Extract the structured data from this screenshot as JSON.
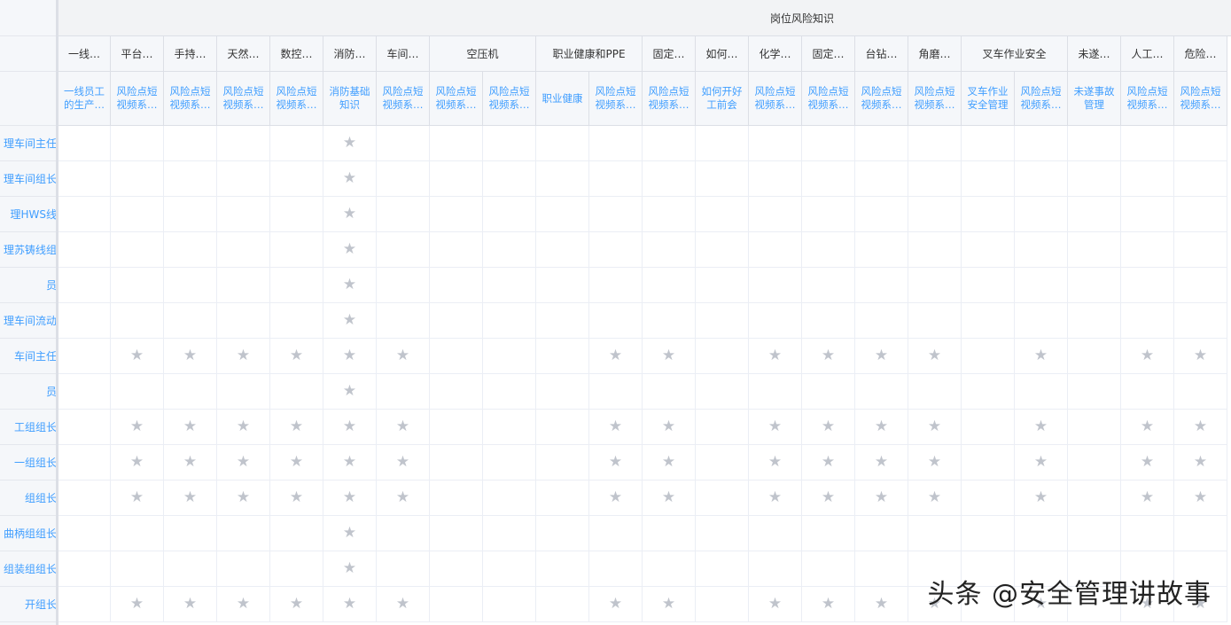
{
  "group_header": "岗位风险知识",
  "columns": [
    {
      "topic": "一线…",
      "course": "一线员工的生产…"
    },
    {
      "topic": "平台…",
      "course": "风险点短视频系…"
    },
    {
      "topic": "手持…",
      "course": "风险点短视频系…"
    },
    {
      "topic": "天然…",
      "course": "风险点短视频系…"
    },
    {
      "topic": "数控…",
      "course": "风险点短视频系…"
    },
    {
      "topic": "消防…",
      "course": "消防基础知识"
    },
    {
      "topic": "车间…",
      "course": "风险点短视频系…"
    },
    {
      "topic": "空压机",
      "course": "风险点短视频系…"
    },
    {
      "topic": "",
      "course": "风险点短视频系…"
    },
    {
      "topic": "职业健康和PPE",
      "course": "职业健康"
    },
    {
      "topic": "",
      "course": "风险点短视频系…"
    },
    {
      "topic": "固定…",
      "course": "风险点短视频系…"
    },
    {
      "topic": "如何…",
      "course": "如何开好工前会"
    },
    {
      "topic": "化学…",
      "course": "风险点短视频系…"
    },
    {
      "topic": "固定…",
      "course": "风险点短视频系…"
    },
    {
      "topic": "台钻…",
      "course": "风险点短视频系…"
    },
    {
      "topic": "角磨…",
      "course": "风险点短视频系…"
    },
    {
      "topic": "叉车作业安全",
      "course": "叉车作业安全管理"
    },
    {
      "topic": "",
      "course": "风险点短视频系…"
    },
    {
      "topic": "未遂…",
      "course": "未遂事故管理"
    },
    {
      "topic": "人工…",
      "course": "风险点短视频系…"
    },
    {
      "topic": "危险…",
      "course": "风险点短视频系…"
    }
  ],
  "rows": [
    {
      "label": "理车间主任",
      "stars": [
        5
      ]
    },
    {
      "label": "理车间组长",
      "stars": [
        5
      ]
    },
    {
      "label": "理HWS线",
      "stars": [
        5
      ]
    },
    {
      "label": "理苏铸线组",
      "stars": [
        5
      ]
    },
    {
      "label": "员",
      "stars": [
        5
      ]
    },
    {
      "label": "理车间流动",
      "stars": [
        5
      ]
    },
    {
      "label": "车间主任",
      "stars": [
        1,
        2,
        3,
        4,
        5,
        6,
        10,
        11,
        13,
        14,
        15,
        16,
        18,
        20,
        21
      ]
    },
    {
      "label": "员",
      "stars": [
        5
      ]
    },
    {
      "label": "工组组长",
      "stars": [
        1,
        2,
        3,
        4,
        5,
        6,
        10,
        11,
        13,
        14,
        15,
        16,
        18,
        20,
        21
      ]
    },
    {
      "label": "一组组长",
      "stars": [
        1,
        2,
        3,
        4,
        5,
        6,
        10,
        11,
        13,
        14,
        15,
        16,
        18,
        20,
        21
      ]
    },
    {
      "label": "组组长",
      "stars": [
        1,
        2,
        3,
        4,
        5,
        6,
        10,
        11,
        13,
        14,
        15,
        16,
        18,
        20,
        21
      ]
    },
    {
      "label": "曲柄组组长",
      "stars": [
        5
      ]
    },
    {
      "label": "组装组组长",
      "stars": [
        5
      ]
    },
    {
      "label": "开组长",
      "stars": [
        1,
        2,
        3,
        4,
        5,
        6,
        10,
        11,
        13,
        14,
        15,
        16,
        18,
        20,
        21
      ]
    }
  ],
  "star_glyph": "★",
  "watermark": "头条 @安全管理讲故事"
}
